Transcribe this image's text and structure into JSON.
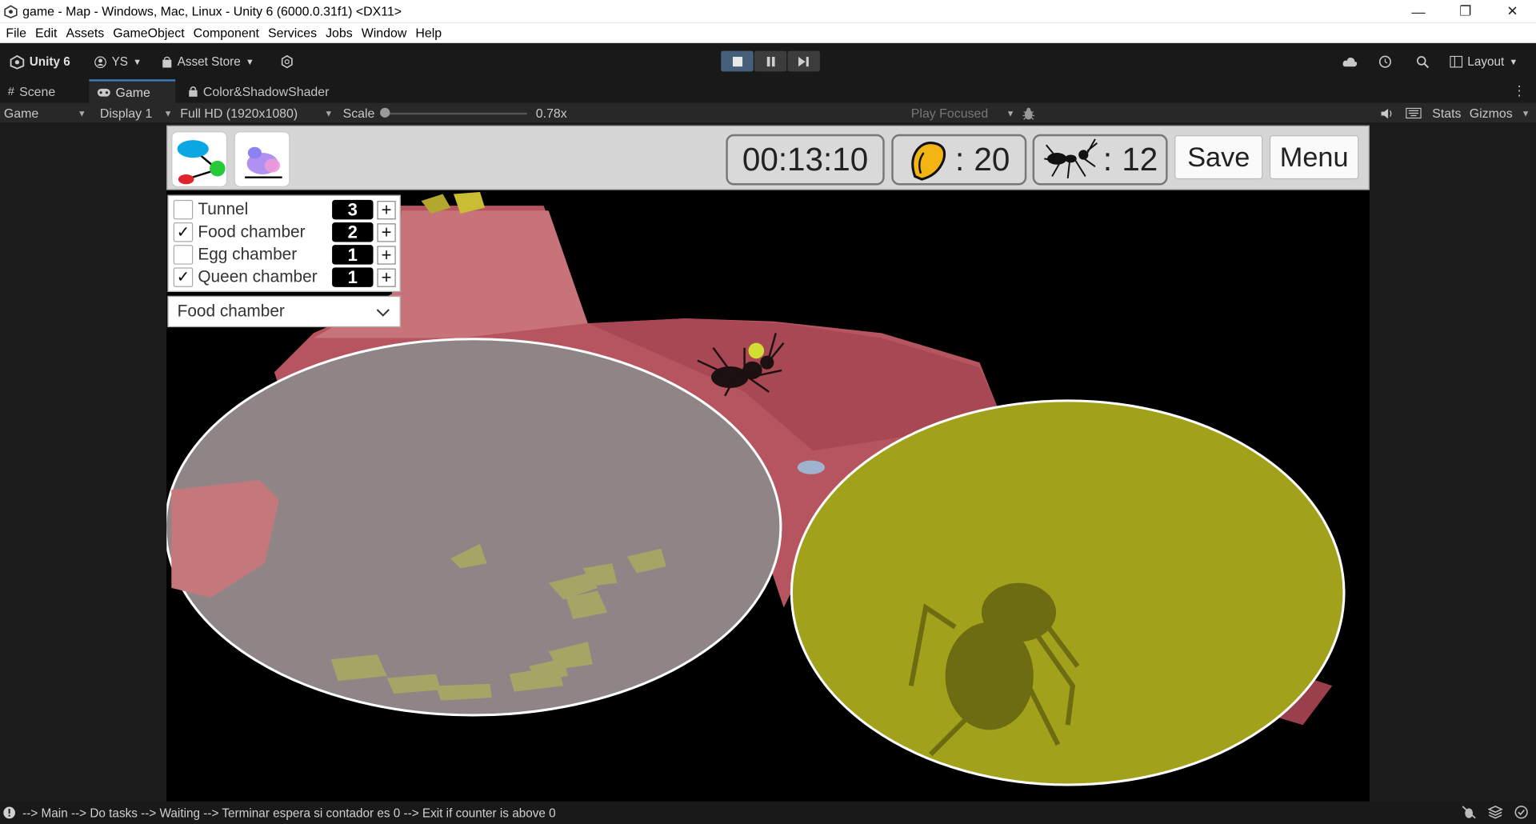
{
  "window": {
    "title": "game - Map - Windows, Mac, Linux - Unity 6 (6000.0.31f1) <DX11>",
    "minimize": "—",
    "restore": "❐",
    "close": "✕"
  },
  "menu": [
    "File",
    "Edit",
    "Assets",
    "GameObject",
    "Component",
    "Services",
    "Jobs",
    "Window",
    "Help"
  ],
  "toolbar": {
    "unity_label": "Unity 6",
    "account": "YS",
    "asset_store": "Asset Store",
    "layout": "Layout"
  },
  "tabs": [
    {
      "label": "Scene",
      "icon": "grid-icon"
    },
    {
      "label": "Game",
      "icon": "gamepad-icon"
    },
    {
      "label": "Color&ShadowShader",
      "icon": "lock-icon"
    }
  ],
  "game_toolbar": {
    "view": "Game",
    "display": "Display 1",
    "resolution": "Full HD (1920x1080)",
    "scale_label": "Scale",
    "scale_value": "0.78x",
    "scale_level": 0.0,
    "play_mode": "Play Focused",
    "stats": "Stats",
    "gizmos": "Gizmos"
  },
  "hud": {
    "timer": "00:13:10",
    "food_sep": ":",
    "food_count": "20",
    "ant_sep": ":",
    "ant_count": "12",
    "save_label": "Save",
    "menu_label": "Menu"
  },
  "chambers": [
    {
      "label": "Tunnel",
      "checked": false,
      "count": "3"
    },
    {
      "label": "Food chamber",
      "checked": true,
      "count": "2"
    },
    {
      "label": "Egg chamber",
      "checked": false,
      "count": "1"
    },
    {
      "label": "Queen chamber",
      "checked": true,
      "count": "1"
    }
  ],
  "plus_label": "+",
  "chamber_dropdown": {
    "selected": "Food chamber"
  },
  "status": {
    "message": "--> Main --> Do tasks --> Waiting --> Terminar espera si contador es 0 --> Exit if counter is above 0"
  },
  "colors": {
    "unity_dark": "#191919",
    "tab_active": "#282828",
    "play_active": "#46607c",
    "food_chamber_fill": "#a2a11c",
    "grey_chamber_fill": "#8f8587",
    "tunnel_pink": "#c06b72"
  }
}
